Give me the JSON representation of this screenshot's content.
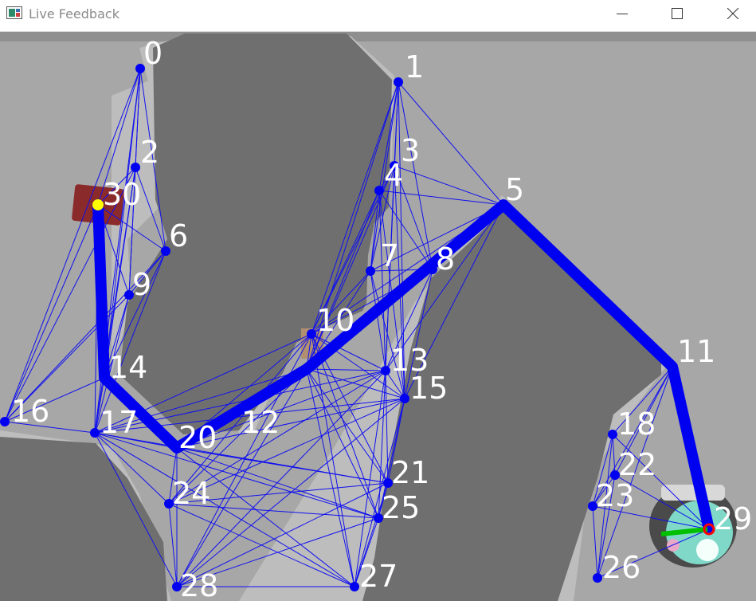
{
  "window": {
    "title": "Live Feedback",
    "controls": [
      "minimize",
      "maximize",
      "close"
    ]
  },
  "feed": {
    "background": "#a3a3a3",
    "obstacle_color": "#6e6e6e",
    "graph_color": "#0000f0",
    "start_marker_color": "#ffff00",
    "goal_marker_color": "#ff0000",
    "heading_color": "#00c000",
    "node_labels": [
      "0",
      "1",
      "2",
      "3",
      "4",
      "5",
      "6",
      "7",
      "8",
      "9",
      "10",
      "11",
      "12",
      "13",
      "14",
      "15",
      "16",
      "17",
      "18",
      "20",
      "21",
      "22",
      "23",
      "24",
      "25",
      "26",
      "27",
      "28",
      "29",
      "30"
    ],
    "path_labels": [
      "30",
      "14",
      "20",
      "12",
      "5",
      "11",
      "29"
    ]
  }
}
